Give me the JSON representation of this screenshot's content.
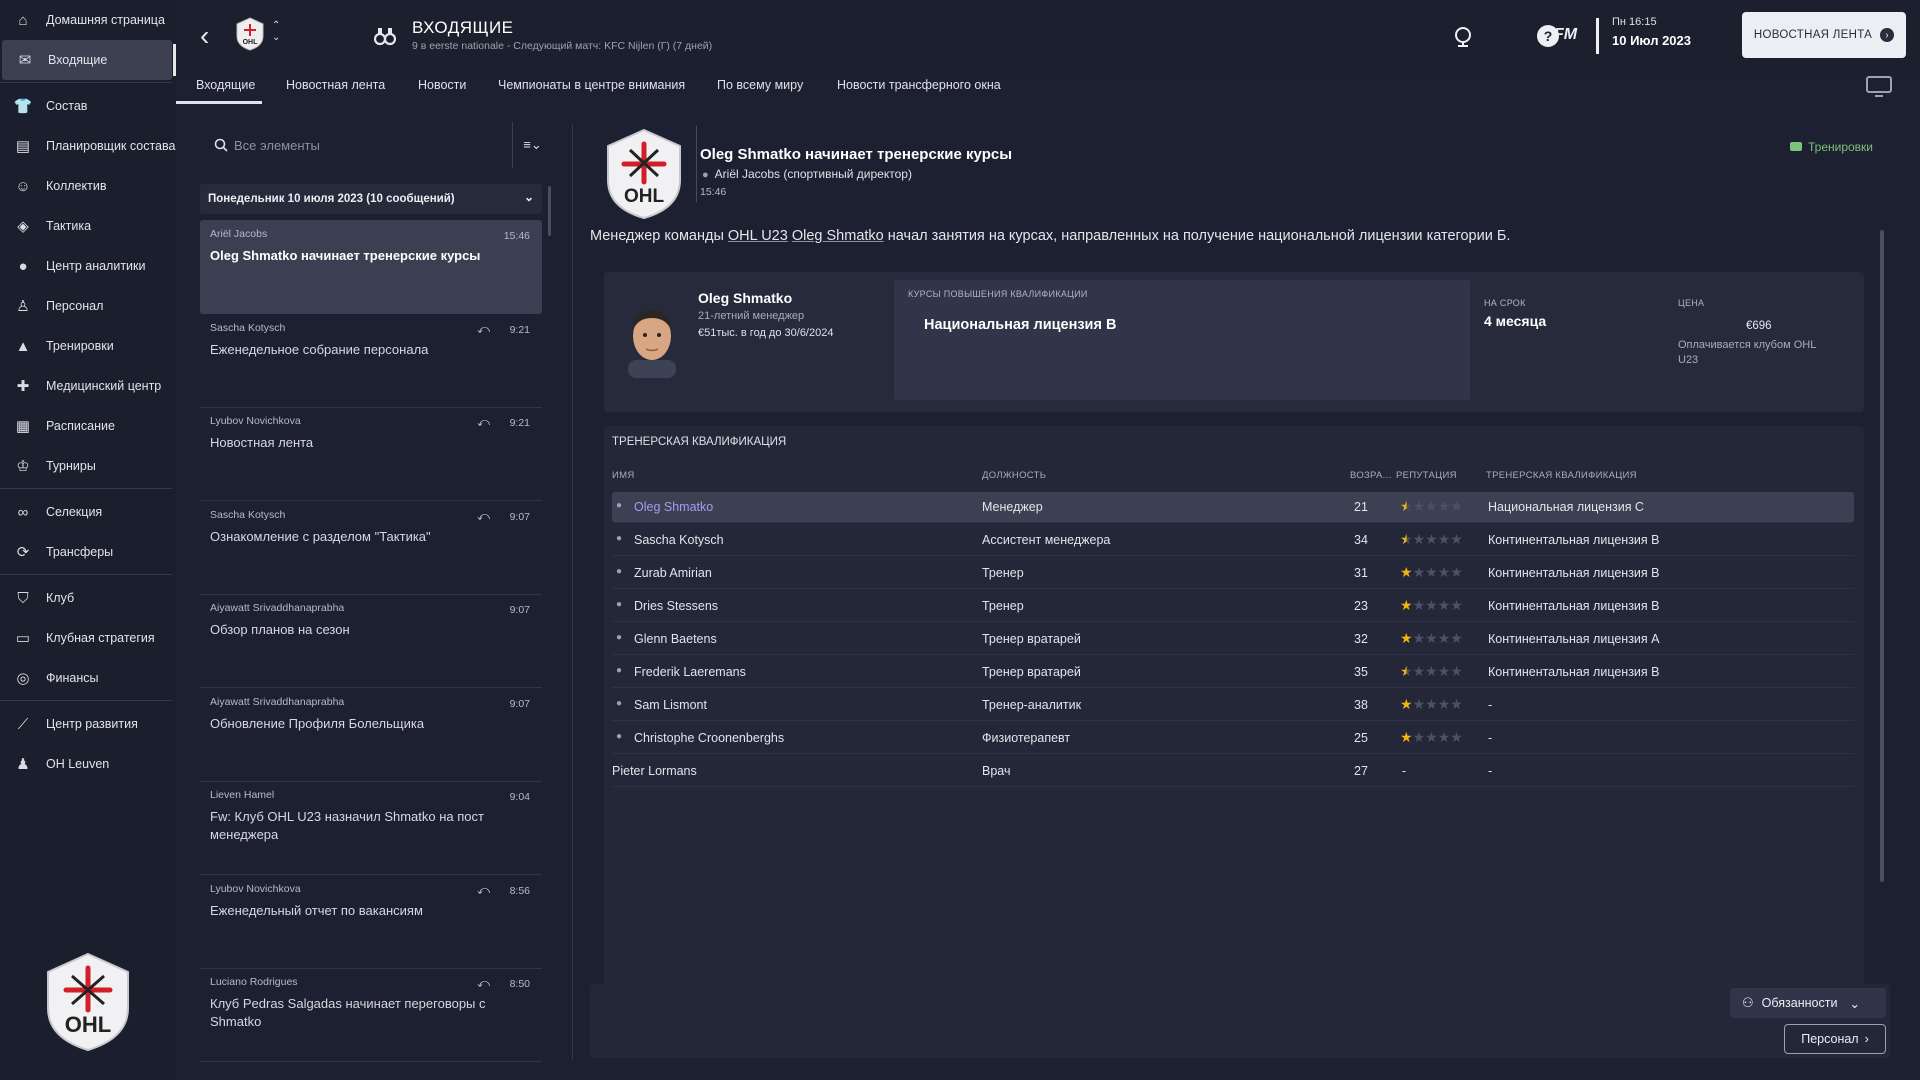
{
  "sidebar": {
    "items": [
      {
        "label": "Домашняя страница",
        "icon": "home-icon"
      },
      {
        "label": "Входящие",
        "icon": "mail-icon"
      },
      {
        "label": "Состав",
        "icon": "shirt-icon"
      },
      {
        "label": "Планировщик состава",
        "icon": "clipboard-icon"
      },
      {
        "label": "Коллектив",
        "icon": "people-icon"
      },
      {
        "label": "Тактика",
        "icon": "tactics-icon"
      },
      {
        "label": "Центр аналитики",
        "icon": "analytics-icon"
      },
      {
        "label": "Персонал",
        "icon": "staff-icon"
      },
      {
        "label": "Тренировки",
        "icon": "cone-icon"
      },
      {
        "label": "Медицинский центр",
        "icon": "medical-icon"
      },
      {
        "label": "Расписание",
        "icon": "calendar-icon"
      },
      {
        "label": "Турниры",
        "icon": "trophy-icon"
      },
      {
        "label": "Селекция",
        "icon": "binoculars-icon"
      },
      {
        "label": "Трансферы",
        "icon": "transfer-icon"
      },
      {
        "label": "Клуб",
        "icon": "shield-icon"
      },
      {
        "label": "Клубная стратегия",
        "icon": "briefcase-icon"
      },
      {
        "label": "Финансы",
        "icon": "coins-icon"
      },
      {
        "label": "Центр развития",
        "icon": "growth-icon"
      },
      {
        "label": "OH Leuven",
        "icon": "team-icon"
      }
    ],
    "club_logo_text": "OHL"
  },
  "header": {
    "title": "ВХОДЯЩИЕ",
    "subtitle": "9 в eerste nationale - Следующий матч: KFC Nijlen (Г) (7 дней)",
    "fm_label": "FM",
    "day_time": "Пн 16:15",
    "date": "10 Июл 2023",
    "news_button": "НОВОСТНАЯ ЛЕНТА"
  },
  "tabs": [
    "Входящие",
    "Новостная лента",
    "Новости",
    "Чемпионаты в центре внимания",
    "По всему миру",
    "Новости трансферного окна"
  ],
  "inbox": {
    "search_placeholder": "Все элементы",
    "group_header": "Понедельник 10 июля 2023 (10 сообщений)",
    "messages": [
      {
        "sender": "Ariël Jacobs",
        "time": "15:46",
        "subject": "Oleg Shmatko начинает тренерские курсы",
        "replied": false
      },
      {
        "sender": "Sascha Kotysch",
        "time": "9:21",
        "subject": "Еженедельное собрание персонала",
        "replied": true
      },
      {
        "sender": "Lyubov Novichkova",
        "time": "9:21",
        "subject": "Новостная лента",
        "replied": true
      },
      {
        "sender": "Sascha Kotysch",
        "time": "9:07",
        "subject": "Ознакомление с разделом \"Тактика\"",
        "replied": true
      },
      {
        "sender": "Aiyawatt Srivaddhanaprabha",
        "time": "9:07",
        "subject": "Обзор планов на сезон",
        "replied": false
      },
      {
        "sender": "Aiyawatt Srivaddhanaprabha",
        "time": "9:07",
        "subject": "Обновление Профиля Болельщика",
        "replied": false
      },
      {
        "sender": "Lieven Hamel",
        "time": "9:04",
        "subject": "Fw: Клуб OHL U23 назначил Shmatko на пост менеджера",
        "replied": false
      },
      {
        "sender": "Lyubov Novichkova",
        "time": "8:56",
        "subject": "Еженедельный отчет по вакансиям",
        "replied": true
      },
      {
        "sender": "Luciano Rodrigues",
        "time": "8:50",
        "subject": "Клуб Pedras Salgadas начинает переговоры с Shmatko",
        "replied": true
      }
    ]
  },
  "message": {
    "title": "Oleg Shmatko начинает тренерские курсы",
    "from": "Ariël Jacobs  (спортивный директор)",
    "time": "15:46",
    "category_link": "Тренировки",
    "body_pre": "Менеджер команды ",
    "body_club": "OHL U23",
    "body_space": " ",
    "body_person": "Oleg Shmatko",
    "body_post": " начал занятия на курсах, направленных на получение национальной лицензии категории Б.",
    "coach": {
      "name": "Oleg Shmatko",
      "age_role": "21-летний менеджер",
      "contract": "€51тыс. в год до 30/6/2024"
    },
    "course": {
      "label": "КУРСЫ ПОВЫШЕНИЯ КВАЛИФИКАЦИИ",
      "value": "Национальная лицензия B",
      "term_label": "НА СРОК",
      "term_value": "4 месяца",
      "price_label": "ЦЕНА",
      "price_value": "€696",
      "price_note": "Оплачивается клубом OHL U23"
    },
    "qualifications": {
      "title": "ТРЕНЕРСКАЯ КВАЛИФИКАЦИЯ",
      "columns": [
        "ИМЯ",
        "ДОЛЖНОСТЬ",
        "ВОЗРА...",
        "РЕПУТАЦИЯ",
        "ТРЕНЕРСКАЯ КВАЛИФИКАЦИЯ"
      ],
      "rows": [
        {
          "name": "Oleg Shmatko",
          "role": "Менеджер",
          "age": "21",
          "stars": 0.5,
          "qual": "Национальная лицензия С"
        },
        {
          "name": "Sascha Kotysch",
          "role": "Ассистент менеджера",
          "age": "34",
          "stars": 0.5,
          "qual": "Континентальная лицензия В"
        },
        {
          "name": "Zurab Amirian",
          "role": "Тренер",
          "age": "31",
          "stars": 1,
          "qual": "Континентальная лицензия В"
        },
        {
          "name": "Dries Stessens",
          "role": "Тренер",
          "age": "23",
          "stars": 1,
          "qual": "Континентальная лицензия В"
        },
        {
          "name": "Glenn Baetens",
          "role": "Тренер вратарей",
          "age": "32",
          "stars": 1,
          "qual": "Континентальная лицензия А"
        },
        {
          "name": "Frederik Laeremans",
          "role": "Тренер вратарей",
          "age": "35",
          "stars": 0.5,
          "qual": "Континентальная лицензия В"
        },
        {
          "name": "Sam Lismont",
          "role": "Тренер-аналитик",
          "age": "38",
          "stars": 1,
          "qual": "-"
        },
        {
          "name": "Christophe Croonenberghs",
          "role": "Физиотерапевт",
          "age": "25",
          "stars": 1,
          "qual": "-"
        },
        {
          "name": "Pieter Lormans",
          "role": "Врач",
          "age": "27",
          "stars": null,
          "stars_text": "-",
          "qual": "-"
        }
      ]
    }
  },
  "footer": {
    "duties_button": "Обязанности",
    "staff_button": "Персонал"
  },
  "colors": {
    "accent_star": "#f2b50a",
    "link_green": "#7dc27a",
    "selected_name": "#a89af0"
  }
}
